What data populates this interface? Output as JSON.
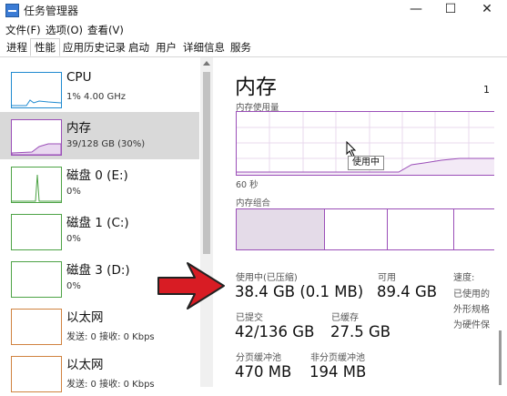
{
  "window": {
    "title": "任务管理器",
    "minimize": "—",
    "maximize": "☐",
    "close": "✕"
  },
  "menu": [
    "文件(F)",
    "选项(O)",
    "查看(V)"
  ],
  "tabs": [
    "进程",
    "性能",
    "应用历史记录",
    "启动",
    "用户",
    "详细信息",
    "服务"
  ],
  "active_tab": "性能",
  "sidebar": [
    {
      "title": "CPU",
      "sub": "1% 4.00 GHz",
      "color": "#1f8ad0"
    },
    {
      "title": "内存",
      "sub": "39/128 GB (30%)",
      "color": "#9b4fb8"
    },
    {
      "title": "磁盘 0 (E:)",
      "sub": "0%",
      "color": "#4da345"
    },
    {
      "title": "磁盘 1 (C:)",
      "sub": "0%",
      "color": "#4da345"
    },
    {
      "title": "磁盘 3 (D:)",
      "sub": "0%",
      "color": "#4da345"
    },
    {
      "title": "以太网",
      "sub": "发送: 0 接收: 0 Kbps",
      "color": "#d0823f"
    },
    {
      "title": "以太网",
      "sub": "发送: 0 接收: 0 Kbps",
      "color": "#d0823f"
    }
  ],
  "main": {
    "title": "内存",
    "usage_label": "内存使用量",
    "time_label": "60 秒",
    "composition_label": "内存组合",
    "tooltip": "使用中",
    "memory_accent": "#9b4fb8",
    "stats": {
      "in_use_label": "使用中(已压缩)",
      "in_use_value": "38.4 GB (0.1 MB)",
      "available_label": "可用",
      "available_value": "89.4 GB",
      "committed_label": "已提交",
      "committed_value": "42/136 GB",
      "cached_label": "已缓存",
      "cached_value": "27.5 GB",
      "paged_label": "分页缓冲池",
      "paged_value": "470 MB",
      "nonpaged_label": "非分页缓冲池",
      "nonpaged_value": "194 MB"
    },
    "right_col": [
      "速度:",
      "已使用的",
      "外形规格",
      "为硬件保"
    ],
    "corner": "1"
  },
  "annotation": {
    "color": "#d81c24"
  }
}
